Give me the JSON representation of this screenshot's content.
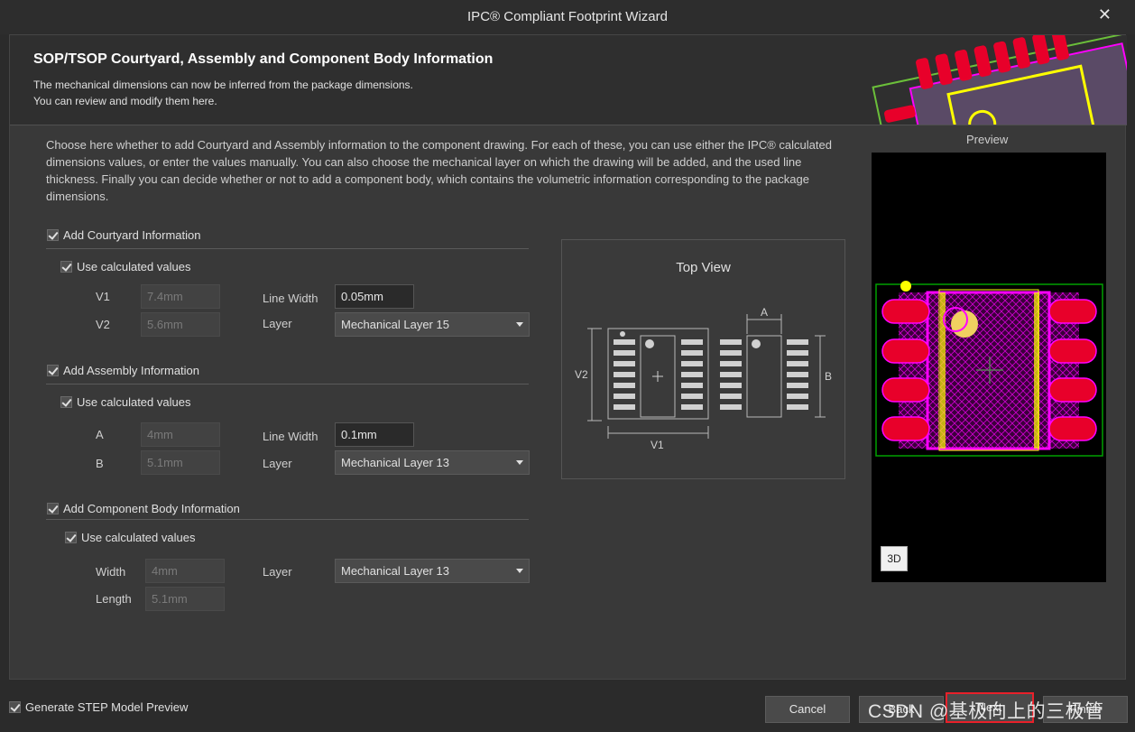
{
  "window": {
    "title": "IPC® Compliant Footprint Wizard"
  },
  "header": {
    "title": "SOP/TSOP Courtyard, Assembly and Component Body Information",
    "subtitle_line1": "The mechanical dimensions can now be inferred from the package dimensions.",
    "subtitle_line2": "You can review and modify them here."
  },
  "intro": "Choose here whether to add Courtyard and Assembly information to the component drawing. For each of these, you can use either the IPC® calculated dimensions values, or enter the values manually. You can also choose the mechanical layer on which the drawing will be added, and the used line thickness. Finally you can decide whether or not to add a component body, which contains the volumetric information corresponding to the package dimensions.",
  "courtyard": {
    "title": "Add Courtyard Information",
    "checked": true,
    "use_calc": "Use calculated values",
    "v1_label": "V1",
    "v1_value": "7.4mm",
    "v2_label": "V2",
    "v2_value": "5.6mm",
    "line_width_label": "Line Width",
    "line_width_value": "0.05mm",
    "layer_label": "Layer",
    "layer_value": "Mechanical Layer 15"
  },
  "assembly": {
    "title": "Add Assembly Information",
    "checked": true,
    "use_calc": "Use calculated values",
    "a_label": "A",
    "a_value": "4mm",
    "b_label": "B",
    "b_value": "5.1mm",
    "line_width_label": "Line Width",
    "line_width_value": "0.1mm",
    "layer_label": "Layer",
    "layer_value": "Mechanical Layer 13"
  },
  "body": {
    "title": "Add Component Body Information",
    "checked": true,
    "use_calc": "Use calculated values",
    "width_label": "Width",
    "width_value": "4mm",
    "length_label": "Length",
    "length_value": "5.1mm",
    "layer_label": "Layer",
    "layer_value": "Mechanical Layer 13"
  },
  "topview": {
    "title": "Top View",
    "dim_a": "A",
    "dim_b": "B",
    "dim_v1": "V1",
    "dim_v2": "V2"
  },
  "preview": {
    "label": "Preview",
    "btn_3d": "3D"
  },
  "footer": {
    "step_label": "Generate STEP Model Preview",
    "cancel": "Cancel",
    "back": "Back",
    "next": "Next",
    "finish": "Finish"
  },
  "watermark": "CSDN @基极向上的三极管",
  "colors": {
    "pad": "#e8002a",
    "courtyard": "#ff00ff",
    "assembly": "#ffff00",
    "board_outline": "#00a000"
  }
}
